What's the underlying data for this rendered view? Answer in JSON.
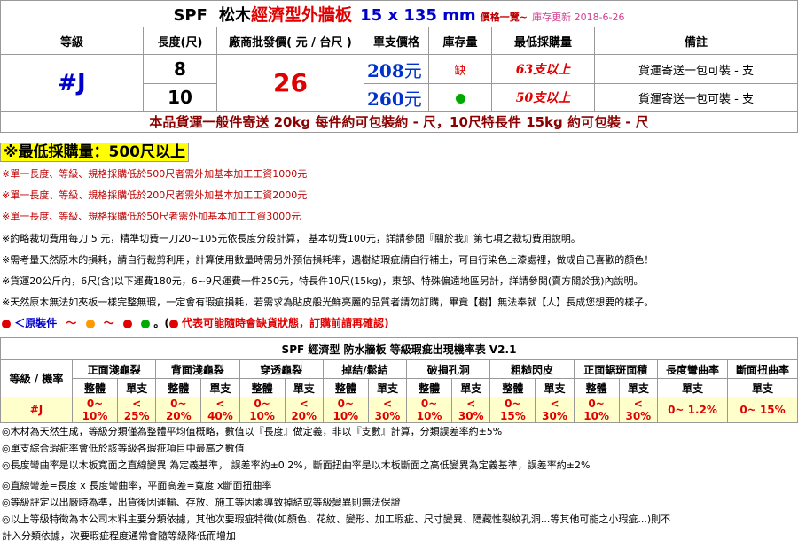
{
  "title": {
    "brand": "SPF",
    "wood": "松木",
    "product": "經濟型外牆板",
    "size": "15 x 135 mm",
    "list": "價格一覽~",
    "update": "庫存更新 2018-6-26"
  },
  "headers": {
    "grade": "等級",
    "length": "長度(尺)",
    "wholesale": "廠商批發價( 元 / 台尺 )",
    "unit_price": "單支價格",
    "stock": "庫存量",
    "min_qty": "最低採購量",
    "remark": "備註"
  },
  "product": {
    "grade": "#J",
    "wholesale_price": "26",
    "rows": [
      {
        "length": "8",
        "unit_price": "208",
        "unit": "元",
        "stock": "缺",
        "min_qty": "63支以上",
        "remark": "貨運寄送一包可裝 - 支"
      },
      {
        "length": "10",
        "unit_price": "260",
        "unit": "元",
        "stock": "",
        "min_qty": "50支以上",
        "remark": "貨運寄送一包可裝 - 支"
      }
    ]
  },
  "shipping_banner": "本品貨運一般件寄送 20kg 每件約可包裝約 - 尺，10尺特長件 15kg 約可包裝 - 尺",
  "min_purchase": "※最低採購量：500尺以上",
  "red_notes": [
    "※單一長度、等級、規格採購低於500尺者需外加基本加工工資1000元",
    "※單一長度、等級、規格採購低於200尺者需外加基本加工工資2000元",
    "※單一長度、等級、規格採購低於50尺者需外加基本加工工資3000元"
  ],
  "notes": [
    "※約略裁切費用每刀 5 元，精準切費一刀20~105元依長度分段計算， 基本切費100元，詳請參閱『關於我』第七項之裁切費用說明。",
    "※需考量天然原木的損耗，請自行裁剪利用，計算使用數量時需另外預估損耗率，遇樹結瑕疵請自行補土，可自行染色上漆處裡，做成自己喜歡的顏色！",
    "※貨運20公斤內，6尺(含)以下運費180元，6~9尺運費一件250元，特長件10尺(15kg)，東部、特殊偏遠地區另計，詳請參閱(賣方關於我)內說明。",
    "※天然原木無法如夾板一樣完整無瑕，一定會有瑕疵損耗，若需求為貼皮般光鮮亮麗的品質者請勿訂購，畢竟【樹】無法奉就【人】長成您想要的樣子。"
  ],
  "legend": {
    "label": "＜原裝件",
    "wave": "～",
    "tail": "。(",
    "warning": "代表可能隨時會缺貨狀態，訂購前請再確認",
    "close": ")",
    "colors": [
      "#e00000",
      "#ff9900",
      "#e00000",
      "#00aa00",
      "#e00000"
    ]
  },
  "defect_table": {
    "title": "SPF 經濟型 防水牆板 等級瑕疵出現機率表 V2.1",
    "corner": "等級 / 機率",
    "columns": [
      "正面淺龜裂",
      "背面淺龜裂",
      "穿透龜裂",
      "掉結/鬆結",
      "破損孔洞",
      "粗糙閃皮",
      "正面鋸斑面積",
      "長度彎曲率",
      "斷面扭曲率"
    ],
    "sub_whole": "整體",
    "sub_single": "單支",
    "row_grade": "#J",
    "values": [
      "0~ 10%",
      "< 25%",
      "0~ 20%",
      "< 40%",
      "0~ 10%",
      "< 20%",
      "0~ 10%",
      "< 30%",
      "0~ 10%",
      "< 30%",
      "0~ 15%",
      "< 30%",
      "0~ 10%",
      "< 30%",
      "0~ 1.2%",
      "0~ 15%"
    ]
  },
  "footnotes": [
    "◎木材為天然生成，等級分類僅為整體平均值概略，數值以『長度』做定義，非以『支數』計算，分類誤差率約±5%",
    "◎單支綜合瑕疵率會低於該等級各瑕疵項目中最高之數值",
    "◎長度彎曲率是以木板寬面之直線變異 為定義基準， 誤差率約±0.2%，斷面扭曲率是以木板斷面之高低變異為定義基準，誤差率約±2%",
    "◎直線彎差=長度 x 長度彎曲率，平面高差=寬度 x斷面扭曲率",
    "◎等級評定以出廠時為準，出貨後因運輸、存放、施工等因素導致掉結或等級變異則無法保證",
    "◎以上等級特徵為本公司木料主要分類依據，其他次要瑕疵特徵(如顏色、花紋、變形、加工瑕疵、尺寸變異、隱藏性裂紋孔洞...等其他可能之小瑕疵...)則不",
    "計入分類依據，次要瑕疵程度通常會隨等級降低而增加"
  ]
}
